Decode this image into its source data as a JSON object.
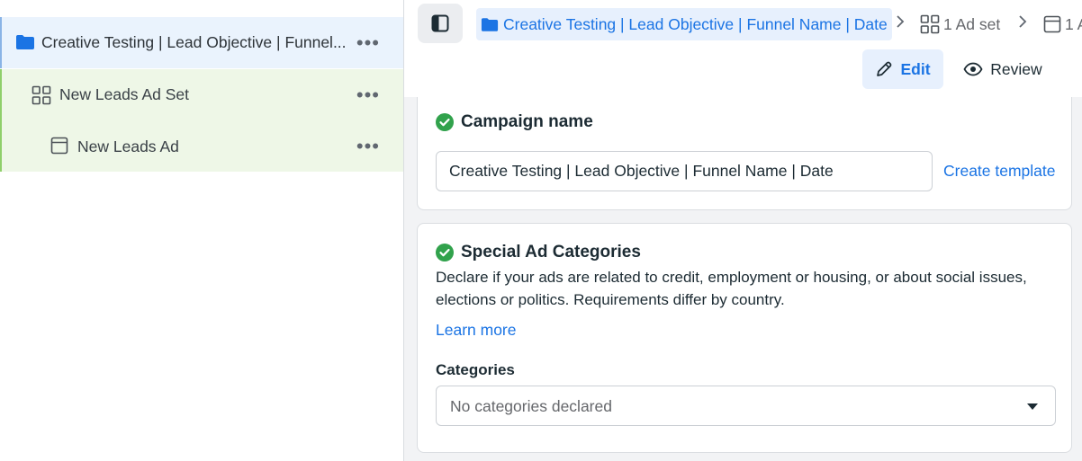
{
  "sidebar": {
    "items": [
      {
        "label": "Creative Testing | Lead Objective | Funnel...",
        "icon": "folder-icon"
      },
      {
        "label": "New Leads Ad Set",
        "icon": "grid-icon"
      },
      {
        "label": "New Leads Ad",
        "icon": "ad-window-icon"
      }
    ],
    "more_label": "•••"
  },
  "breadcrumb": {
    "campaign": "Creative Testing | Lead Objective | Funnel Name | Date",
    "adset": "1 Ad set",
    "ad": "1 A"
  },
  "toolbar": {
    "edit_label": "Edit",
    "review_label": "Review"
  },
  "campaign_name": {
    "title": "Campaign name",
    "value": "Creative Testing | Lead Objective | Funnel Name | Date",
    "create_template": "Create template"
  },
  "special_ad_categories": {
    "title": "Special Ad Categories",
    "description": "Declare if your ads are related to credit, employment or housing, or about social issues, elections or politics. Requirements differ by country.",
    "learn_more": "Learn more",
    "categories_label": "Categories",
    "categories_value": "No categories declared"
  },
  "colors": {
    "accent": "#1b74e4",
    "success": "#31a24c",
    "campaign_row_bg": "#eaf3fd",
    "adset_row_bg": "#eef7e7"
  }
}
